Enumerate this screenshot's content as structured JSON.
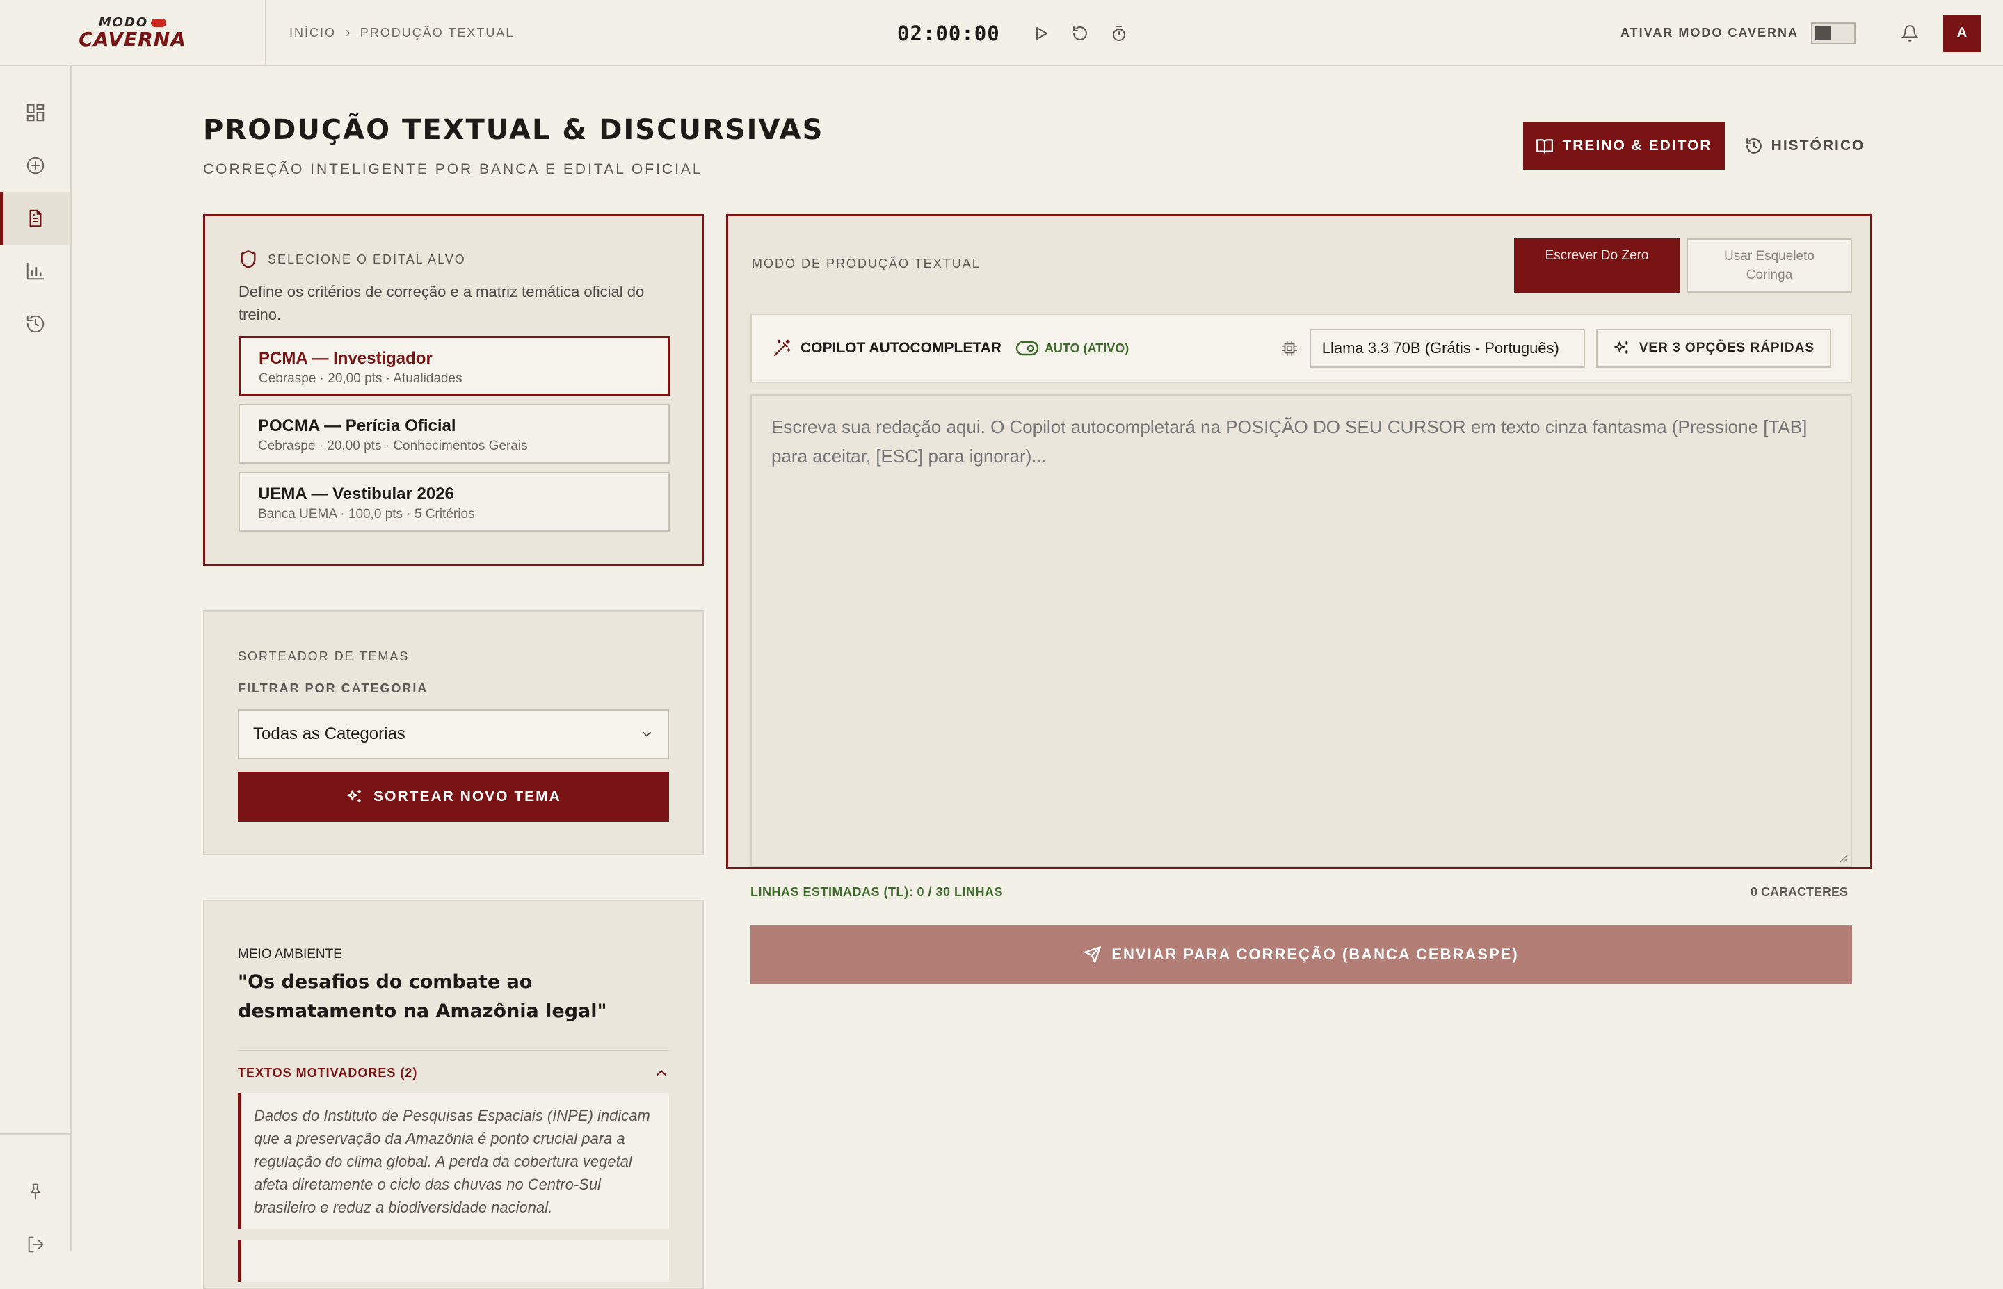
{
  "app": {
    "logo_top": "MODO",
    "logo_bottom": "CAVERNA"
  },
  "header": {
    "breadcrumb": [
      "Início",
      "Produção Textual"
    ],
    "timer": "02:00:00",
    "cave_mode_label": "ATIVAR MODO CAVERNA",
    "avatar_initial": "A"
  },
  "sidebar": {
    "items": [
      {
        "icon": "dashboard-icon",
        "active": false
      },
      {
        "icon": "add-circle-icon",
        "active": false
      },
      {
        "icon": "document-icon",
        "active": true
      },
      {
        "icon": "bar-chart-icon",
        "active": false
      },
      {
        "icon": "history-icon",
        "active": false
      }
    ],
    "bottom": [
      {
        "icon": "pin-icon"
      },
      {
        "icon": "logout-icon"
      }
    ]
  },
  "page": {
    "title": "PRODUÇÃO TEXTUAL & DISCURSIVAS",
    "subtitle": "CORREÇÃO INTELIGENTE POR BANCA E EDITAL OFICIAL",
    "btn_primary": "TREINO & EDITOR",
    "btn_history": "HISTÓRICO"
  },
  "edital": {
    "label": "SELECIONE O EDITAL ALVO",
    "description": "Define os critérios de correção e a matriz temática oficial do treino.",
    "options": [
      {
        "title": "PCMA — Investigador",
        "meta": "Cebraspe · 20,00 pts · Atualidades",
        "selected": true
      },
      {
        "title": "POCMA — Perícia Oficial",
        "meta": "Cebraspe · 20,00 pts · Conhecimentos Gerais",
        "selected": false
      },
      {
        "title": "UEMA — Vestibular 2026",
        "meta": "Banca UEMA · 100,0 pts · 5 Critérios",
        "selected": false
      }
    ]
  },
  "sorteador": {
    "label": "SORTEADOR DE TEMAS",
    "filter_label": "FILTRAR POR CATEGORIA",
    "select_value": "Todas as Categorias",
    "button": "SORTEAR NOVO TEMA"
  },
  "tema": {
    "category": "MEIO AMBIENTE",
    "title": "\"Os desafios do combate ao desmatamento na Amazônia legal\"",
    "motivadores_label": "TEXTOS MOTIVADORES (2)",
    "motivador_1": "Dados do Instituto de Pesquisas Espaciais (INPE) indicam que a preservação da Amazônia é ponto crucial para a regulação do clima global. A perda da cobertura vegetal afeta diretamente o ciclo das chuvas no Centro-Sul brasileiro e reduz a biodiversidade nacional."
  },
  "editor": {
    "mode_label": "MODO DE PRODUÇÃO TEXTUAL",
    "mode_btn_1": "Escrever Do Zero",
    "mode_btn_2": "Usar Esqueleto Coringa",
    "copilot_title": "COPILOT AUTOCOMPLETAR",
    "copilot_status": "AUTO (ATIVO)",
    "model_value": "Llama 3.3 70B (Grátis - Português)",
    "quick_options": "VER 3 OPÇÕES RÁPIDAS",
    "placeholder": "Escreva sua redação aqui. O Copilot autocompletará na POSIÇÃO DO SEU CURSOR em texto cinza fantasma (Pressione [TAB] para aceitar, [ESC] para ignorar)...",
    "lines_stat": "LINHAS ESTIMADAS (TL): 0 / 30 LINHAS",
    "chars_stat": "0 CARACTERES",
    "send_button": "ENVIAR PARA CORREÇÃO (BANCA CEBRASPE)"
  },
  "colors": {
    "accent": "#7a1414",
    "accent_disabled": "#b27e76",
    "success": "#3e6a2c",
    "background": "#f3f0e7",
    "panel": "#eae6dc"
  }
}
